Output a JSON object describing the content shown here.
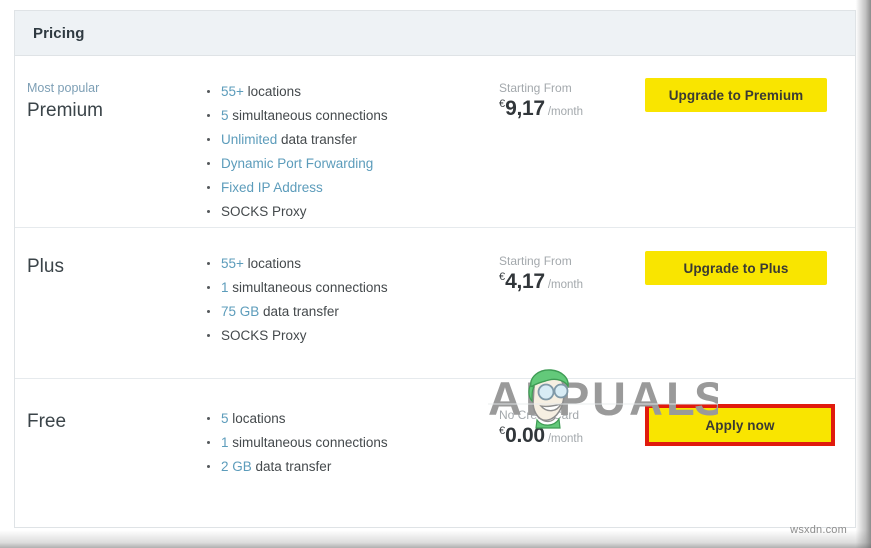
{
  "card": {
    "header_title": "Pricing"
  },
  "plans": [
    {
      "badge": "Most popular",
      "name": "Premium",
      "features": [
        {
          "highlight": "55+",
          "rest": " locations"
        },
        {
          "highlight": "5",
          "rest": " simultaneous connections"
        },
        {
          "highlight": "Unlimited",
          "rest": " data transfer"
        },
        {
          "highlight": "Dynamic Port Forwarding",
          "rest": ""
        },
        {
          "highlight": "Fixed IP Address",
          "rest": ""
        },
        {
          "highlight": "",
          "rest": "SOCKS Proxy"
        }
      ],
      "price_caption": "Starting From",
      "currency": "€",
      "amount": "9,17",
      "period": "/month",
      "button_label": "Upgrade to Premium",
      "button_highlighted": false
    },
    {
      "badge": "",
      "name": "Plus",
      "features": [
        {
          "highlight": "55+",
          "rest": " locations"
        },
        {
          "highlight": "1",
          "rest": " simultaneous connections"
        },
        {
          "highlight": "75 GB",
          "rest": " data transfer"
        },
        {
          "highlight": "",
          "rest": "SOCKS Proxy"
        }
      ],
      "price_caption": "Starting From",
      "currency": "€",
      "amount": "4,17",
      "period": "/month",
      "button_label": "Upgrade to Plus",
      "button_highlighted": false
    },
    {
      "badge": "",
      "name": "Free",
      "features": [
        {
          "highlight": "5",
          "rest": " locations"
        },
        {
          "highlight": "1",
          "rest": " simultaneous connections"
        },
        {
          "highlight": "2 GB",
          "rest": " data transfer"
        }
      ],
      "price_caption": "No Credit Card",
      "currency": "€",
      "amount": "0.00",
      "period": "/month",
      "button_label": "Apply now",
      "button_highlighted": true
    }
  ],
  "watermark": {
    "text": "APPUALS"
  },
  "source_tag": {
    "text": "wsxdn.com"
  },
  "colors": {
    "button_yellow": "#f9e500",
    "highlight_red": "#e01b0d",
    "link_blue": "#5c9cbb",
    "header_bg": "#eef2f5",
    "badge_blue": "#7d9fb5"
  }
}
